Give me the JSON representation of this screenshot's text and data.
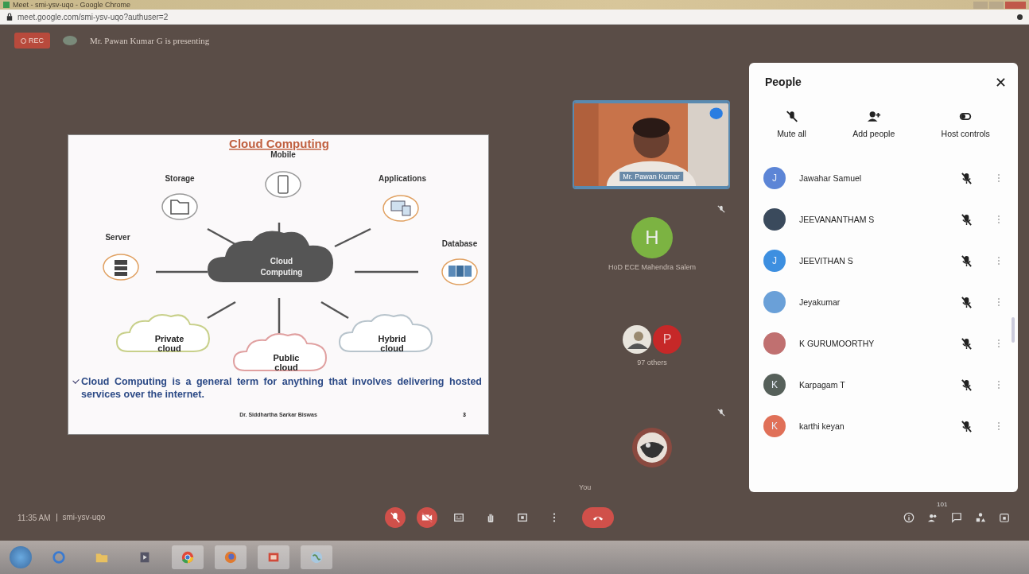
{
  "window": {
    "title": "Meet - smi-ysv-uqo - Google Chrome"
  },
  "address_bar": {
    "url": "meet.google.com/smi-ysv-uqo?authuser=2"
  },
  "meeting": {
    "recording": true,
    "rec_label": "REC",
    "presenter_banner": "Mr. Pawan Kumar G is presenting"
  },
  "slide": {
    "title": "Cloud Computing",
    "center_lines": [
      "Cloud",
      "Computing"
    ],
    "nodes": [
      {
        "label": "Mobile",
        "kind": "mobile"
      },
      {
        "label": "Storage",
        "kind": "storage"
      },
      {
        "label": "Applications",
        "kind": "applications"
      },
      {
        "label": "Server",
        "kind": "server"
      },
      {
        "label": "Database",
        "kind": "database"
      }
    ],
    "clouds": [
      {
        "lines": [
          "Private",
          "cloud"
        ],
        "color": "#c8d08a"
      },
      {
        "lines": [
          "Public",
          "cloud"
        ],
        "color": "#e0a0a0"
      },
      {
        "lines": [
          "Hybrid",
          "cloud"
        ],
        "color": "#b8c4cc"
      }
    ],
    "bullet": "Cloud Computing is a general term for anything that involves delivering hosted services over the internet.",
    "footer": "Dr. Siddhartha Sarkar Biswas",
    "page": "3"
  },
  "tiles": [
    {
      "kind": "video",
      "name": "Mr. Pawan Kumar"
    },
    {
      "kind": "avatar",
      "avatar": "H",
      "color": "#7cb342",
      "name": "HoD ECE Mahendra Salem",
      "muted": true
    },
    {
      "kind": "group",
      "avatar": "P",
      "color": "#c62828",
      "name": "97 others"
    },
    {
      "kind": "self",
      "name": "You",
      "muted": true
    }
  ],
  "people_panel": {
    "title": "People",
    "actions": [
      {
        "label": "Mute all",
        "kind": "mute"
      },
      {
        "label": "Add people",
        "kind": "add"
      },
      {
        "label": "Host controls",
        "kind": "host"
      }
    ],
    "participants": [
      {
        "name": "Jawahar Samuel",
        "avatar": "J",
        "color": "#5c85d6",
        "muted": true
      },
      {
        "name": "JEEVANANTHAM S",
        "color": "#3a4a5c",
        "muted": true
      },
      {
        "name": "JEEVITHAN S",
        "avatar": "J",
        "color": "#3d8fe0",
        "muted": true
      },
      {
        "name": "Jeyakumar",
        "color": "#6aa0d8",
        "muted": true
      },
      {
        "name": "K GURUMOORTHY",
        "color": "#c07070",
        "muted": true
      },
      {
        "name": "Karpagam T",
        "avatar": "K",
        "color": "#56605a",
        "muted": true
      },
      {
        "name": "karthi keyan",
        "avatar": "K",
        "color": "#e07058",
        "muted": true
      }
    ]
  },
  "bottom_bar": {
    "time": "11:35 AM",
    "code": "smi-ysv-uqo",
    "controls": [
      {
        "kind": "mic",
        "on": false
      },
      {
        "kind": "camera",
        "on": false
      },
      {
        "kind": "captions"
      },
      {
        "kind": "hand"
      },
      {
        "kind": "present"
      },
      {
        "kind": "more"
      },
      {
        "kind": "hangup"
      }
    ],
    "people_count": "101"
  }
}
